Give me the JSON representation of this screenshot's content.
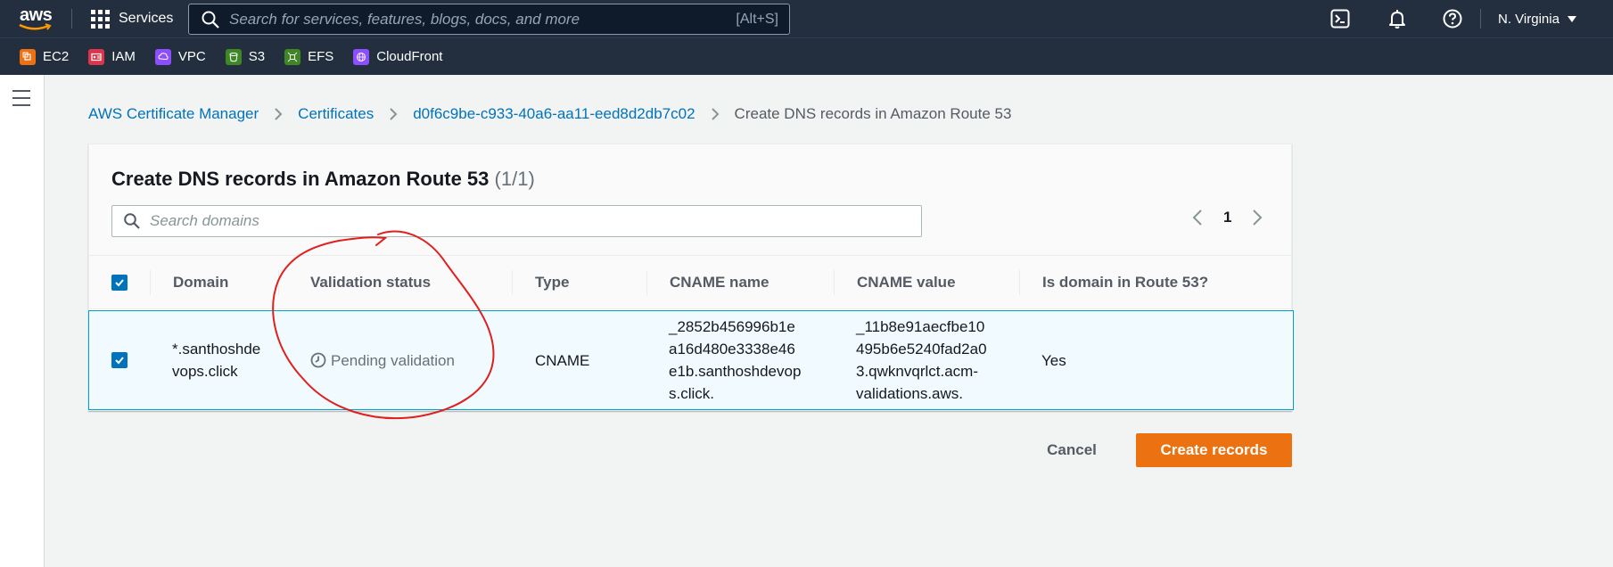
{
  "topnav": {
    "logo_text": "aws",
    "services_label": "Services",
    "search_placeholder": "Search for services, features, blogs, docs, and more",
    "search_shortcut": "[Alt+S]",
    "icons": [
      "cloudshell-icon",
      "bell-icon",
      "help-icon"
    ],
    "region_label": "N. Virginia"
  },
  "favorites": [
    {
      "label": "EC2",
      "color": "#ec7211"
    },
    {
      "label": "IAM",
      "color": "#dd344c"
    },
    {
      "label": "VPC",
      "color": "#8c4fff"
    },
    {
      "label": "S3",
      "color": "#3f8624"
    },
    {
      "label": "EFS",
      "color": "#3f8624"
    },
    {
      "label": "CloudFront",
      "color": "#8c4fff"
    }
  ],
  "breadcrumb": [
    {
      "label": "AWS Certificate Manager",
      "link": true
    },
    {
      "label": "Certificates",
      "link": true
    },
    {
      "label": "d0f6c9be-c933-40a6-aa11-eed8d2db7c02",
      "link": true
    },
    {
      "label": "Create DNS records in Amazon Route 53",
      "link": false
    }
  ],
  "panel": {
    "title": "Create DNS records in Amazon Route 53",
    "count": "(1/1)",
    "search_placeholder": "Search domains",
    "page_number": "1"
  },
  "table": {
    "columns": [
      "Domain",
      "Validation status",
      "Type",
      "CNAME name",
      "CNAME value",
      "Is domain in Route 53?"
    ],
    "rows": [
      {
        "selected": true,
        "domain": [
          "*.santhoshde",
          "vops.click"
        ],
        "validation_status": "Pending validation",
        "type": "CNAME",
        "cname_name": [
          "_2852b456996b1e",
          "a16d480e3338e46",
          "e1b.santhoshdevop",
          "s.click."
        ],
        "cname_value": [
          "_11b8e91aecfbe10",
          "495b6e5240fad2a0",
          "3.qwknvqrlct.acm-",
          "validations.aws."
        ],
        "in_route53": "Yes"
      }
    ]
  },
  "actions": {
    "cancel_label": "Cancel",
    "create_label": "Create records"
  },
  "colors": {
    "nav_bg": "#232f3e",
    "link": "#0073bb",
    "primary": "#ec7211",
    "annotation": "#e0201d"
  }
}
